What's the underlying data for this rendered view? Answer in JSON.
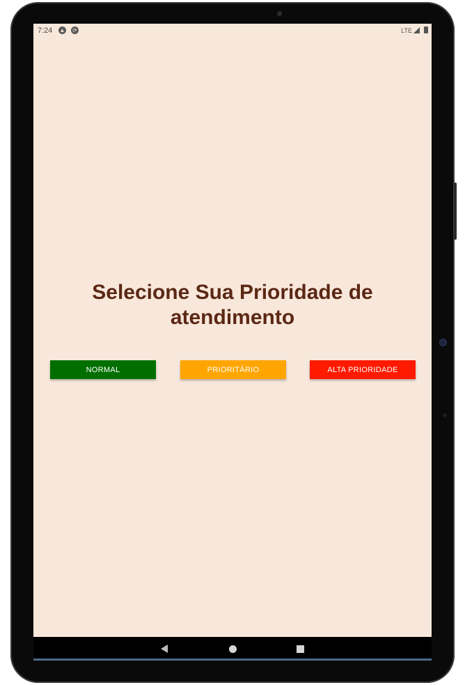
{
  "statusbar": {
    "time": "7:24",
    "network": "LTE",
    "icons": [
      "app-notification-icon",
      "sync-icon",
      "signal-icon",
      "battery-icon"
    ]
  },
  "main": {
    "title": "Selecione Sua Prioridade de atendimento",
    "buttons": [
      {
        "label": "NORMAL",
        "color": "#006f00"
      },
      {
        "label": "PRIORITÁRIO",
        "color": "#ffa500"
      },
      {
        "label": "ALTA PRIORIDADE",
        "color": "#ff1a00"
      }
    ]
  },
  "navigation": {
    "icons": [
      "back-icon",
      "home-icon",
      "recents-icon"
    ]
  },
  "colors": {
    "background": "#f8e8db",
    "title": "#5b2815"
  }
}
